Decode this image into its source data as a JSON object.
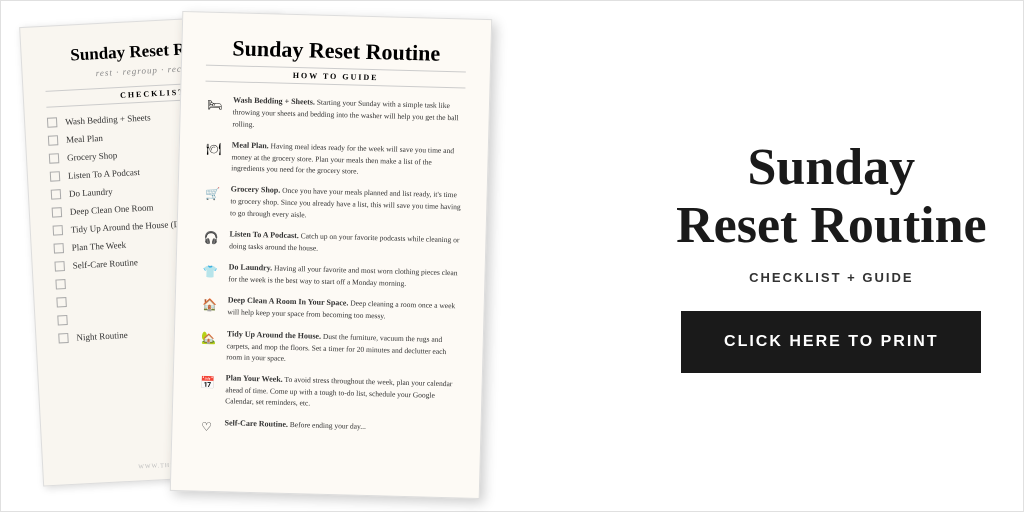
{
  "checklist_page": {
    "title": "Sunday Reset Routine",
    "subtitle": "rest · regroup · recharge",
    "section_label": "CHECKLIST",
    "items": [
      "Wash Bedding + Sheets",
      "Meal Plan",
      "Grocery Shop",
      "Listen To A Podcast",
      "Do Laundry",
      "Deep Clean One Room",
      "Tidy Up Around the House (Dust, Vac…",
      "Plan The Week",
      "Self-Care Routine",
      "",
      "",
      "",
      "Night Routine"
    ],
    "footer": "WWW.THERISAM..."
  },
  "guide_page": {
    "title": "Sunday Reset Routine",
    "subtitle": "HOW TO GUIDE",
    "items": [
      {
        "icon": "🛏",
        "title": "Wash Bedding + Sheets.",
        "text": "Starting your Sunday with a simple task like throwing your sheets and bedding into the washer will help you get the ball rolling."
      },
      {
        "icon": "🍽",
        "title": "Meal Plan.",
        "text": "Having meal ideas ready for the week will save you time and money at the grocery store. Plan your meals then make a list of the ingredients you need for the grocery store."
      },
      {
        "icon": "🛒",
        "title": "Grocery Shop.",
        "text": "Once you have your meals planned and list ready, it's time to grocery shop. Since you already have a list, this will save you time having to go through every aisle."
      },
      {
        "icon": "🎧",
        "title": "Listen To A Podcast.",
        "text": "Catch up on your favorite podcasts while cleaning or doing tasks around the house."
      },
      {
        "icon": "👕",
        "title": "Do Laundry.",
        "text": "Having all your favorite and most worn clothing pieces clean for the week is the best way to start off a Monday morning."
      },
      {
        "icon": "🏠",
        "title": "Deep Clean A Room In Your Space.",
        "text": "Deep cleaning a room once a week will help keep your space from becoming too messy."
      },
      {
        "icon": "🏡",
        "title": "Tidy Up Around the House.",
        "text": "Dust the furniture, vacuum the rugs and carpets, and mop the floors. Set a timer for 20 minutes and declutter each room in your space."
      },
      {
        "icon": "📅",
        "title": "Plan Your Week.",
        "text": "To avoid stress throughout the week, plan your calendar ahead of time. Come up with a tough to-do list, schedule your Google Calendar, set reminders, etc."
      },
      {
        "icon": "♡",
        "title": "Self-Care Routine.",
        "text": "Before ending your day..."
      }
    ]
  },
  "right_section": {
    "title_line1": "Sunday",
    "title_line2": "Reset Routine",
    "subtitle": "CHECKLIST + GUIDE",
    "button_label": "CLICK HERE TO PRINT"
  }
}
